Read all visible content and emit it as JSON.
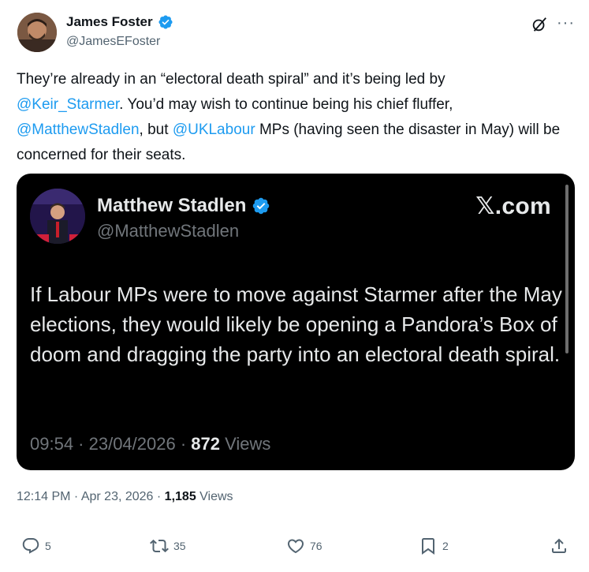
{
  "author": {
    "name": "James Foster",
    "handle": "@JamesEFoster",
    "verified": true
  },
  "icons": {
    "verified": "verified-badge-icon",
    "grok": "grok-icon",
    "more": "more-icon",
    "reply": "reply-icon",
    "repost": "repost-icon",
    "like": "like-icon",
    "bookmark": "bookmark-icon",
    "share": "share-icon"
  },
  "tweet": {
    "p1": "They’re already in an “electoral death spiral” and it’s being led by",
    "mention1": "@Keir_Starmer",
    "p2": ".  You’d may wish to continue being his chief fluffer,",
    "mention2": "@MatthewStadlen",
    "p3": ", but",
    "mention3": "@UKLabour",
    "p4": "MPs (having seen the disaster in May) will be concerned for their seats."
  },
  "embedded": {
    "name": "Matthew Stadlen",
    "handle": "@MatthewStadlen",
    "site": "𝕏.com",
    "text": "If Labour MPs were to move against Starmer after the May elections, they would likely be opening a Pandora’s Box of doom and dragging the party into an electoral death spiral.",
    "time": "09:54 · 23/04/2026 · ",
    "views_count": "872",
    "views_label": " Views"
  },
  "meta": {
    "time": "12:14 PM · Apr 23, 2026 · ",
    "views_count": "1,185",
    "views_label": " Views"
  },
  "actions": {
    "replies": "5",
    "reposts": "35",
    "likes": "76",
    "bookmarks": "2"
  },
  "colors": {
    "link": "#1d9bf0",
    "verified": "#1d9bf0",
    "secondary_text": "#536471",
    "card_bg": "#000000"
  }
}
